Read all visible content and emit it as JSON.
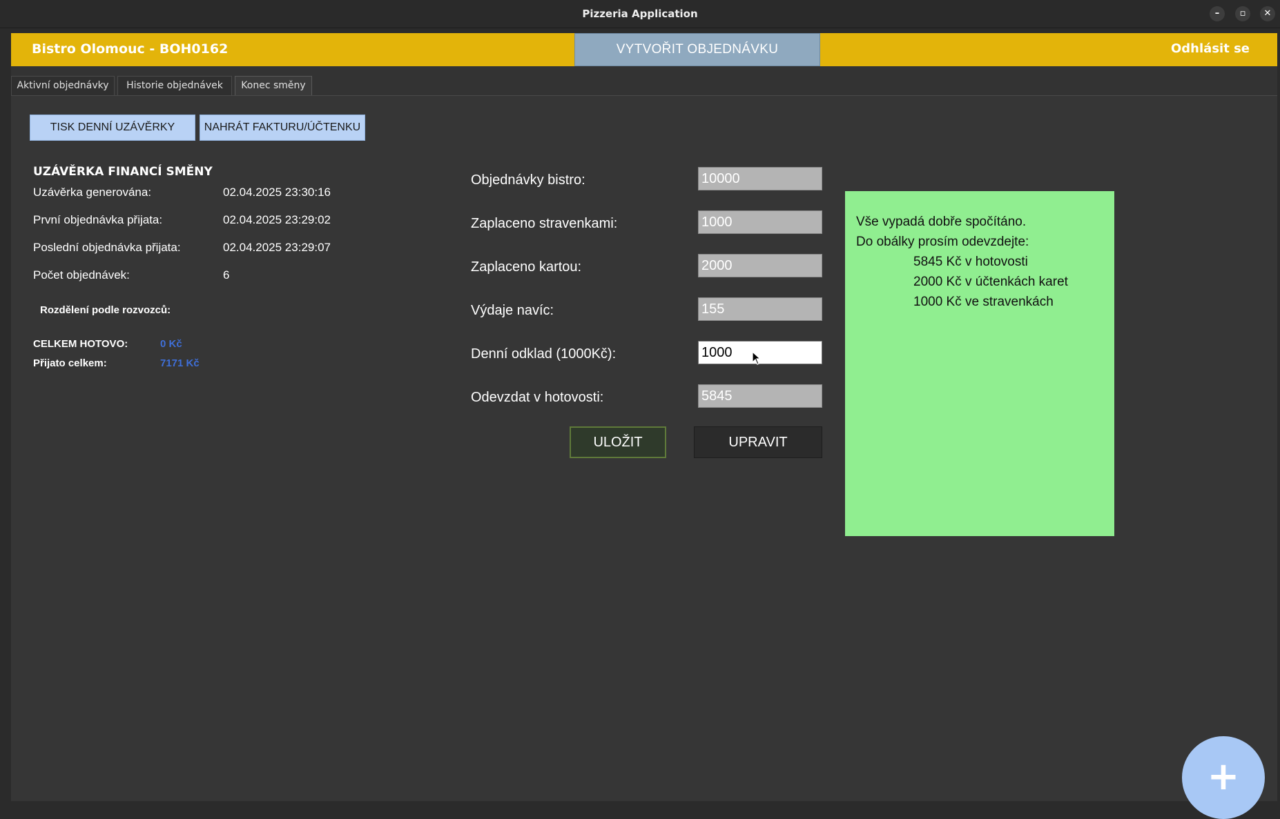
{
  "window": {
    "title": "Pizzeria Application",
    "minimize": "–",
    "maximize": "▫",
    "close": "✕"
  },
  "header": {
    "bistro_name": "Bistro Olomouc - BOH0162",
    "create_order": "VYTVOŘIT OBJEDNÁVKU",
    "logout": "Odhlásit se",
    "accent_color": "#e3b40a"
  },
  "tabs": [
    {
      "label": "Aktivní objednávky"
    },
    {
      "label": "Historie objednávek"
    },
    {
      "label": "Konec směny",
      "selected": true
    }
  ],
  "actions": {
    "print_label": "TISK DENNÍ UZÁVĚRKY",
    "upload_label": "NAHRÁT FAKTURU/ÚČTENKU"
  },
  "summary": {
    "title": "UZÁVĚRKA FINANCÍ SMĚNY",
    "rows": [
      {
        "label": "Uzávěrka generována:",
        "value": "02.04.2025 23:30:16"
      },
      {
        "label": "První objednávka přijata:",
        "value": "02.04.2025 23:29:02"
      },
      {
        "label": "Poslední objednávka přijata:",
        "value": "02.04.2025 23:29:07"
      },
      {
        "label": "Počet objednávek:",
        "value": "6"
      }
    ],
    "split_label": "Rozdělení podle rozvozců:",
    "totals": [
      {
        "label": "CELKEM HOTOVO:",
        "value": "0 Kč"
      },
      {
        "label": "Přijato celkem:",
        "value": "7171 Kč"
      }
    ]
  },
  "form": {
    "fields": [
      {
        "label": "Objednávky bistro:",
        "value": "10000"
      },
      {
        "label": "Zaplaceno stravenkami:",
        "value": "1000"
      },
      {
        "label": "Zaplaceno kartou:",
        "value": "2000"
      },
      {
        "label": "Výdaje navíc:",
        "value": "155"
      },
      {
        "label": "Denní odklad (1000Kč):",
        "value": "1000"
      },
      {
        "label": "Odevzdat v hotovosti:",
        "value": "5845"
      }
    ],
    "save_label": "ULOŽIT",
    "edit_label": "UPRAVIT"
  },
  "note": {
    "color": "#90ee90",
    "line1": "Vše vypadá dobře spočítáno.",
    "line2": "Do obálky prosím odevzdejte:",
    "item1": "5845 Kč v hotovosti",
    "item2": "2000 Kč v účtenkách karet",
    "item3": "1000 Kč ve stravenkách"
  },
  "fab": {
    "label": "+"
  }
}
